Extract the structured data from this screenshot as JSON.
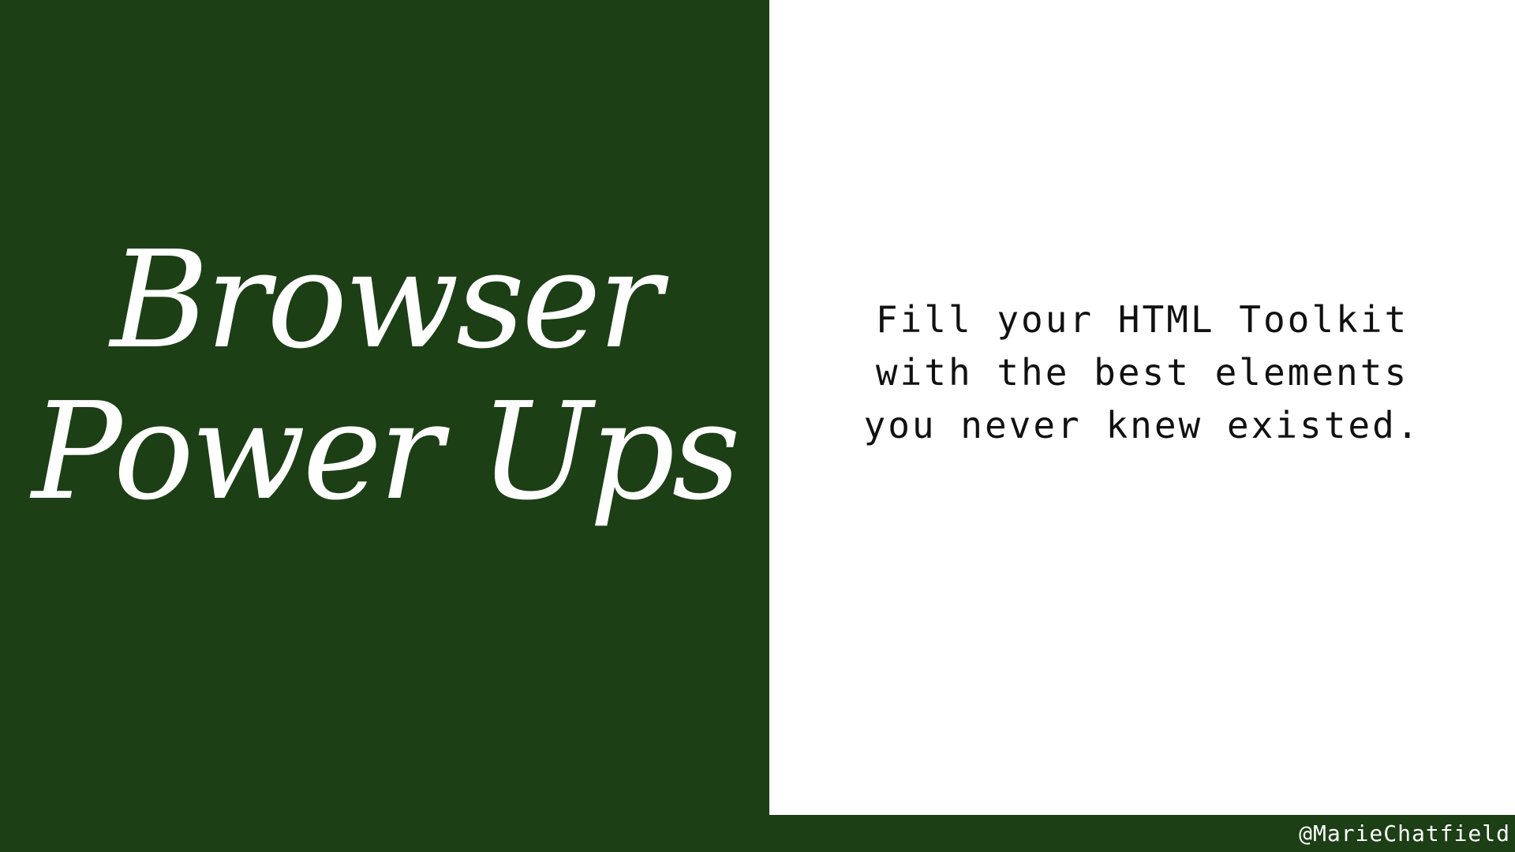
{
  "slide": {
    "title_lines": [
      "Browser",
      "Power Ups"
    ],
    "tagline_lines": [
      "Fill your HTML Toolkit",
      "with the best elements",
      "you never knew existed."
    ],
    "handle": "@MarieChatfield"
  },
  "colors": {
    "background_green": "#1c3f16",
    "panel_white": "#ffffff",
    "title_text": "#ffffff",
    "tagline_text": "#111111"
  }
}
